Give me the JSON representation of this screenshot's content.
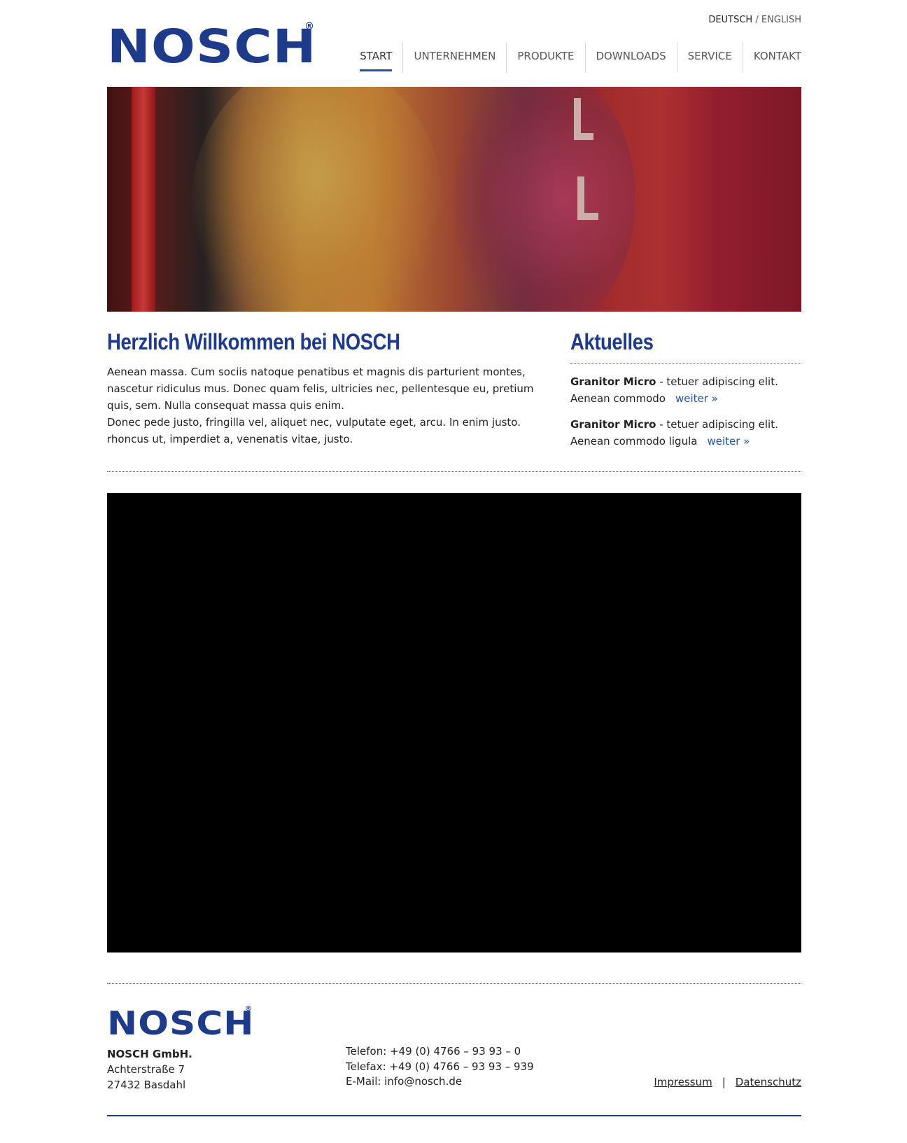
{
  "brand": {
    "name": "NOSCH",
    "registered": "®",
    "color": "#1e3a8a"
  },
  "header": {
    "lang_de": "DEUTSCH",
    "lang_sep": "/",
    "lang_en": "ENGLISH",
    "nav": [
      {
        "label": "START",
        "active": true
      },
      {
        "label": "UNTERNEHMEN",
        "active": false
      },
      {
        "label": "PRODUKTE",
        "active": false
      },
      {
        "label": "DOWNLOADS",
        "active": false
      },
      {
        "label": "SERVICE",
        "active": false
      },
      {
        "label": "KONTAKT",
        "active": false
      }
    ]
  },
  "welcome": {
    "title": "Herzlich Willkommen bei NOSCH",
    "para1": "Aenean massa. Cum sociis natoque penatibus et magnis dis parturient montes, nascetur ridiculus mus. Donec quam felis, ultricies nec, pellentesque eu, pretium quis, sem. Nulla consequat massa quis enim.",
    "para2": "Donec pede justo, fringilla vel, aliquet nec, vulputate eget, arcu. In enim justo. rhoncus ut, imperdiet a, venenatis vitae, justo."
  },
  "news": {
    "title": "Aktuelles",
    "items": [
      {
        "product": "Granitor Micro",
        "text1": " - tetuer adipiscing elit.",
        "text2": "Aenean commodo",
        "more": "weiter »"
      },
      {
        "product": "Granitor Micro",
        "text1": " - tetuer adipiscing elit.",
        "text2": "Aenean commodo ligula",
        "more": "weiter »"
      }
    ]
  },
  "footer": {
    "company": "NOSCH GmbH.",
    "street": "Achterstraße 7",
    "city": "27432 Basdahl",
    "phone": "Telefon: +49 (0) 4766 – 93 93 – 0",
    "fax": "Telefax: +49 (0) 4766 – 93 93 – 939",
    "email": "E-Mail: info@nosch.de",
    "impressum": "Impressum",
    "separator": "|",
    "datenschutz": "Datenschutz"
  }
}
